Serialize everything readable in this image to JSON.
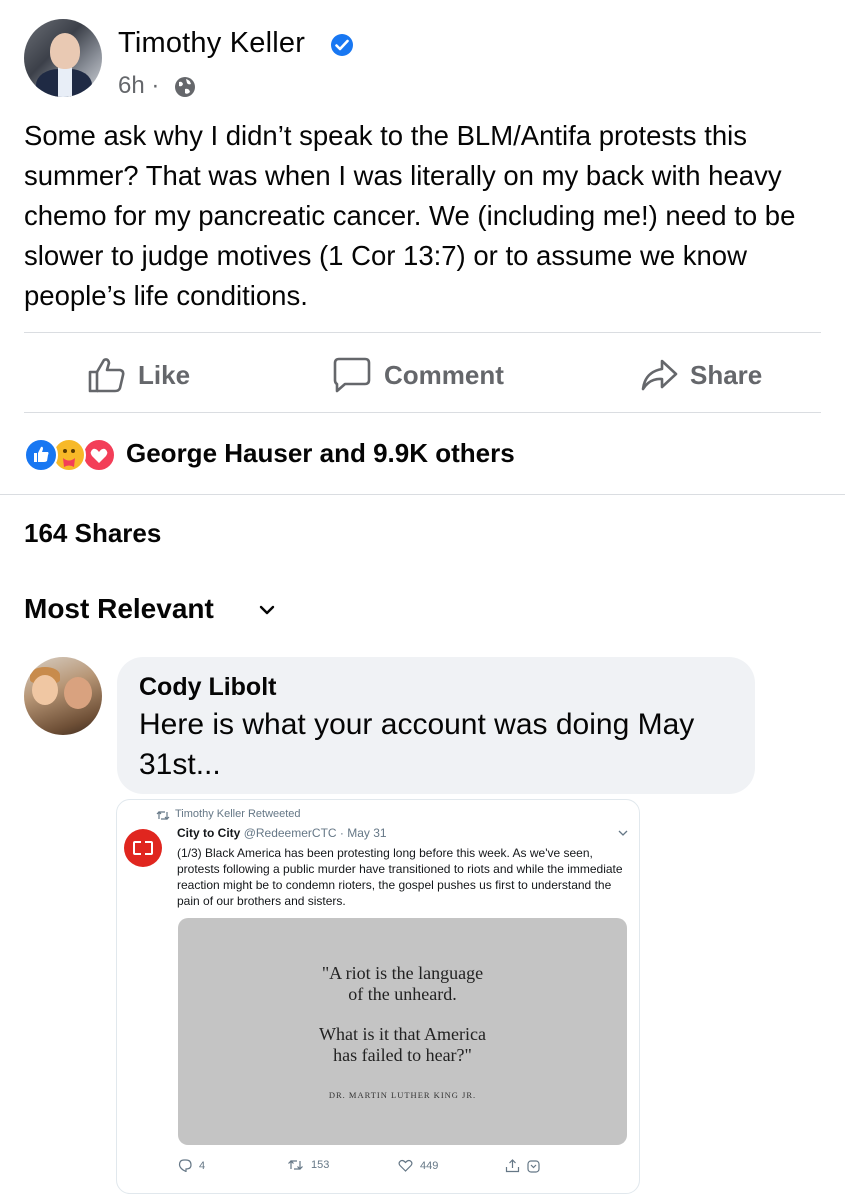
{
  "post": {
    "author": "Timothy Keller",
    "time": "6h ·",
    "text": "Some ask why I didn’t speak to the BLM/Antifa protests this summer? That was when I was literally on my back with heavy chemo for my pancreatic cancer. We (including me!) need to be slower to judge motives (1 Cor 13:7) or to assume we know people’s life conditions.",
    "icons": {
      "verified": "verified-badge-icon",
      "audience": "globe-icon"
    }
  },
  "actions": {
    "like": "Like",
    "comment": "Comment",
    "share": "Share"
  },
  "reactions": {
    "summary": "George Hauser and 9.9K others",
    "types": [
      "like-reaction-icon",
      "care-reaction-icon",
      "love-reaction-icon"
    ]
  },
  "shares": "164 Shares",
  "comments_sort": {
    "label": "Most Relevant"
  },
  "comment": {
    "author": "Cody Libolt",
    "text": "Here is what your account was doing May 31st..."
  },
  "embedded_tweet": {
    "retweet_label": "Timothy Keller Retweeted",
    "display_name": "City to City",
    "handle_date": "@RedeemerCTC · May 31",
    "text": "(1/3) Black America has been protesting long before this week. As we've seen, protests following a public murder have transitioned to riots and while the immediate reaction might be to condemn rioters, the gospel pushes us first to understand the pain of our brothers and sisters.",
    "quote_line1": "\"A riot is the language",
    "quote_line2": "of the unheard.",
    "quote_line3": "What is it that America",
    "quote_line4": "has failed to hear?\"",
    "quote_attribution": "DR. MARTIN LUTHER KING JR.",
    "replies": "4",
    "retweets": "153",
    "likes": "449"
  },
  "colors": {
    "accent": "#1877f2",
    "muted": "#65676b",
    "bubble": "#f0f2f5",
    "twitter_muted": "#657786"
  }
}
